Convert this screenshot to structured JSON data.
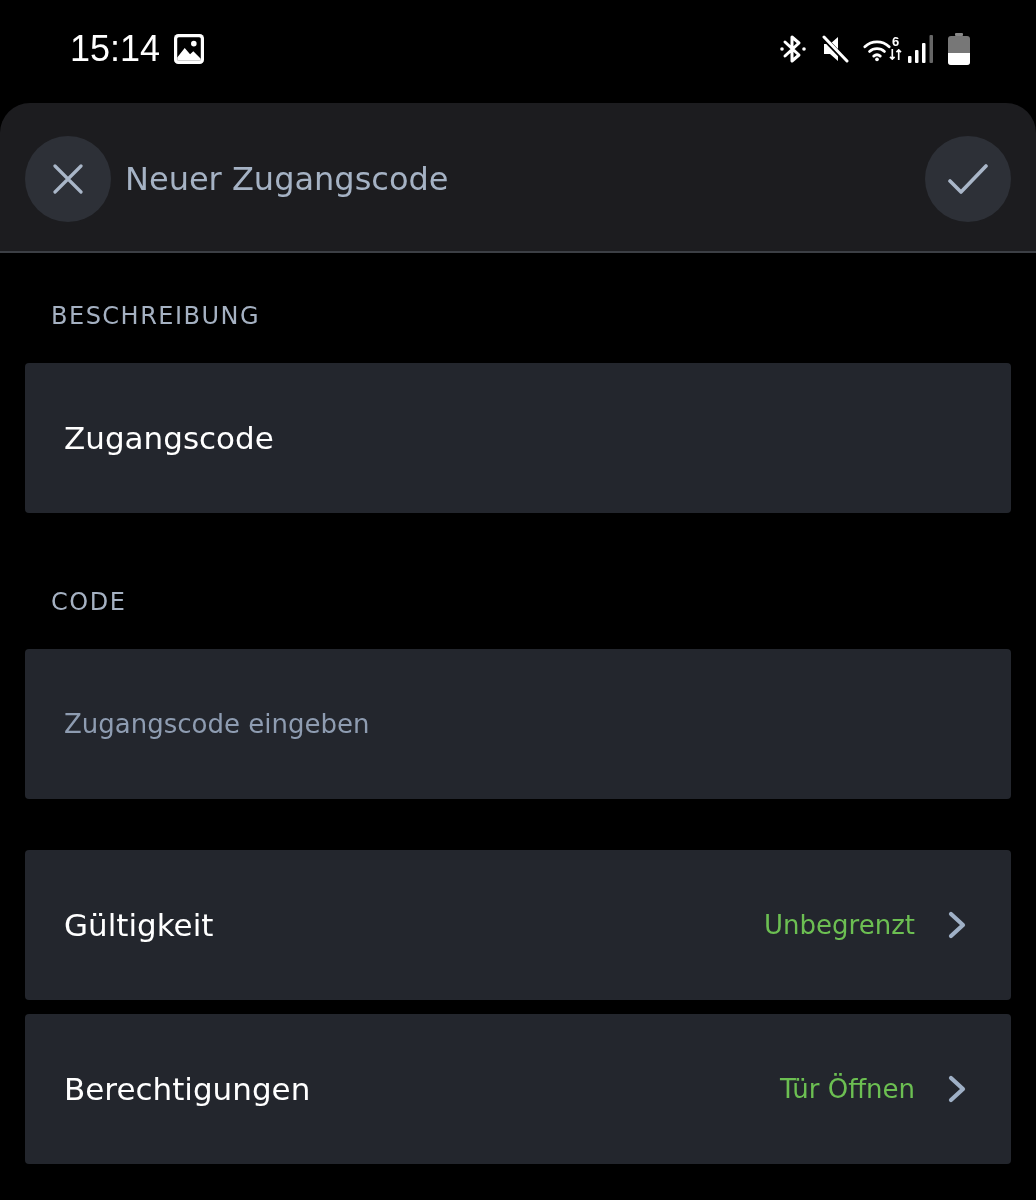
{
  "status_bar": {
    "time": "15:14",
    "wifi_badge": "6"
  },
  "header": {
    "title": "Neuer Zugangscode"
  },
  "sections": [
    {
      "label": "BESCHREIBUNG",
      "field": {
        "value": "Zugangscode"
      }
    },
    {
      "label": "CODE",
      "field": {
        "placeholder": "Zugangscode eingeben"
      }
    }
  ],
  "settings": [
    {
      "label": "Gültigkeit",
      "value": "Unbegrenzt"
    },
    {
      "label": "Berechtigungen",
      "value": "Tür Öffnen"
    }
  ]
}
